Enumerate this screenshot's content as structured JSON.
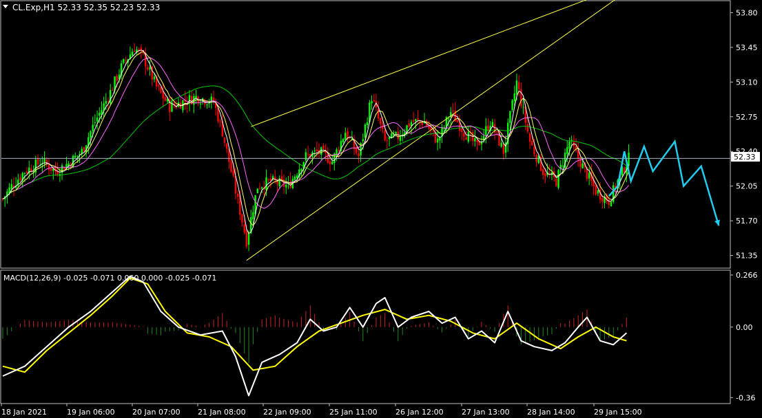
{
  "header": {
    "symbol_line": "CL.Exp,H1  52.33 52.35 52.23 52.33",
    "macd_line": "MACD(12,26,9) -0.025 -0.071 0.060 0.000 -0.025 -0.071"
  },
  "colors": {
    "background": "#000000",
    "frame": "#c0c0c0",
    "bull_candle": "#00ff00",
    "bear_candle": "#ff0000",
    "ma_fast": "#ffffff",
    "ma_medium": "#ffff66",
    "ma_slow": "#ff66ff",
    "ma_long": "#00cc00",
    "trendline": "#ffff44",
    "projection": "#22ccee",
    "macd_line": "#ffffff",
    "signal_line": "#ffff00",
    "hist_positive": "#cc2222",
    "hist_negative": "#228822",
    "price_tag_bg": "#ffffff"
  },
  "chart_data": [
    {
      "type": "candlestick",
      "symbol": "CL.Exp",
      "timeframe": "H1",
      "last_price": "52.33",
      "y_ticks": [
        "53.80",
        "53.45",
        "53.10",
        "52.75",
        "52.40",
        "52.05",
        "51.70",
        "51.35"
      ],
      "ylim": [
        51.25,
        53.9
      ],
      "x_ticks": [
        "18 Jan 2021",
        "19 Jan 06:00",
        "20 Jan 07:00",
        "21 Jan 08:00",
        "22 Jan 09:00",
        "25 Jan 11:00",
        "26 Jan 12:00",
        "27 Jan 13:00",
        "28 Jan 14:00",
        "29 Jan 15:00"
      ],
      "close_path": [
        {
          "x": 0,
          "y": 51.92
        },
        {
          "x": 4,
          "y": 52.05
        },
        {
          "x": 10,
          "y": 52.2
        },
        {
          "x": 18,
          "y": 52.3
        },
        {
          "x": 24,
          "y": 52.2
        },
        {
          "x": 30,
          "y": 52.28
        },
        {
          "x": 36,
          "y": 52.4
        },
        {
          "x": 42,
          "y": 52.7
        },
        {
          "x": 48,
          "y": 52.95
        },
        {
          "x": 54,
          "y": 53.25
        },
        {
          "x": 60,
          "y": 53.45
        },
        {
          "x": 64,
          "y": 53.35
        },
        {
          "x": 70,
          "y": 53.05
        },
        {
          "x": 76,
          "y": 52.85
        },
        {
          "x": 82,
          "y": 52.9
        },
        {
          "x": 88,
          "y": 52.95
        },
        {
          "x": 96,
          "y": 52.9
        },
        {
          "x": 100,
          "y": 52.6
        },
        {
          "x": 104,
          "y": 52.2
        },
        {
          "x": 108,
          "y": 51.8
        },
        {
          "x": 111,
          "y": 51.5
        },
        {
          "x": 116,
          "y": 52.05
        },
        {
          "x": 122,
          "y": 52.1
        },
        {
          "x": 130,
          "y": 52.05
        },
        {
          "x": 138,
          "y": 52.35
        },
        {
          "x": 144,
          "y": 52.4
        },
        {
          "x": 150,
          "y": 52.3
        },
        {
          "x": 156,
          "y": 52.6
        },
        {
          "x": 162,
          "y": 52.35
        },
        {
          "x": 168,
          "y": 52.95
        },
        {
          "x": 174,
          "y": 52.5
        },
        {
          "x": 180,
          "y": 52.55
        },
        {
          "x": 186,
          "y": 52.7
        },
        {
          "x": 192,
          "y": 52.7
        },
        {
          "x": 198,
          "y": 52.5
        },
        {
          "x": 204,
          "y": 52.8
        },
        {
          "x": 210,
          "y": 52.6
        },
        {
          "x": 216,
          "y": 52.45
        },
        {
          "x": 222,
          "y": 52.7
        },
        {
          "x": 228,
          "y": 52.4
        },
        {
          "x": 234,
          "y": 53.1
        },
        {
          "x": 240,
          "y": 52.5
        },
        {
          "x": 246,
          "y": 52.2
        },
        {
          "x": 252,
          "y": 52.1
        },
        {
          "x": 258,
          "y": 52.5
        },
        {
          "x": 264,
          "y": 52.25
        },
        {
          "x": 270,
          "y": 52.0
        },
        {
          "x": 276,
          "y": 51.9
        },
        {
          "x": 280,
          "y": 52.1
        },
        {
          "x": 285,
          "y": 52.33
        }
      ],
      "series": [
        {
          "name": "",
          "values": []
        }
      ],
      "trendlines": [
        {
          "x": [
            113,
            280
          ],
          "y": [
            52.65,
            54.05
          ]
        },
        {
          "x": [
            111,
            280
          ],
          "y": [
            51.3,
            53.95
          ]
        }
      ],
      "projection": [
        {
          "x": 276,
          "y": 51.95
        },
        {
          "x": 280,
          "y": 52.05
        },
        {
          "x": 283,
          "y": 52.4
        },
        {
          "x": 286,
          "y": 52.1
        },
        {
          "x": 292,
          "y": 52.45
        },
        {
          "x": 296,
          "y": 52.2
        },
        {
          "x": 306,
          "y": 52.5
        },
        {
          "x": 310,
          "y": 52.05
        },
        {
          "x": 318,
          "y": 52.25
        },
        {
          "x": 326,
          "y": 51.65
        }
      ]
    },
    {
      "type": "macd",
      "title": "MACD(12,26,9)",
      "y_ticks": [
        "0.266",
        "0.00",
        "-0.36"
      ],
      "ylim": [
        -0.38,
        0.28
      ],
      "zero": 0.0,
      "macd_path": [
        {
          "x": 0,
          "y": -0.25
        },
        {
          "x": 10,
          "y": -0.2
        },
        {
          "x": 20,
          "y": -0.1
        },
        {
          "x": 30,
          "y": 0.0
        },
        {
          "x": 40,
          "y": 0.08
        },
        {
          "x": 50,
          "y": 0.18
        },
        {
          "x": 58,
          "y": 0.26
        },
        {
          "x": 64,
          "y": 0.23
        },
        {
          "x": 72,
          "y": 0.08
        },
        {
          "x": 80,
          "y": 0.0
        },
        {
          "x": 90,
          "y": -0.04
        },
        {
          "x": 100,
          "y": -0.02
        },
        {
          "x": 106,
          "y": -0.15
        },
        {
          "x": 112,
          "y": -0.35
        },
        {
          "x": 118,
          "y": -0.18
        },
        {
          "x": 126,
          "y": -0.14
        },
        {
          "x": 134,
          "y": -0.08
        },
        {
          "x": 140,
          "y": 0.04
        },
        {
          "x": 146,
          "y": -0.02
        },
        {
          "x": 152,
          "y": 0.0
        },
        {
          "x": 158,
          "y": 0.1
        },
        {
          "x": 164,
          "y": 0.0
        },
        {
          "x": 170,
          "y": 0.12
        },
        {
          "x": 174,
          "y": 0.15
        },
        {
          "x": 180,
          "y": 0.0
        },
        {
          "x": 186,
          "y": 0.05
        },
        {
          "x": 194,
          "y": 0.08
        },
        {
          "x": 200,
          "y": 0.02
        },
        {
          "x": 206,
          "y": 0.05
        },
        {
          "x": 212,
          "y": -0.06
        },
        {
          "x": 218,
          "y": -0.02
        },
        {
          "x": 224,
          "y": -0.08
        },
        {
          "x": 230,
          "y": 0.08
        },
        {
          "x": 236,
          "y": -0.07
        },
        {
          "x": 242,
          "y": -0.1
        },
        {
          "x": 250,
          "y": -0.12
        },
        {
          "x": 256,
          "y": -0.08
        },
        {
          "x": 262,
          "y": 0.0
        },
        {
          "x": 266,
          "y": 0.05
        },
        {
          "x": 272,
          "y": -0.07
        },
        {
          "x": 278,
          "y": -0.09
        },
        {
          "x": 284,
          "y": -0.03
        }
      ],
      "signal_path": [
        {
          "x": 0,
          "y": -0.2
        },
        {
          "x": 10,
          "y": -0.23
        },
        {
          "x": 20,
          "y": -0.12
        },
        {
          "x": 30,
          "y": -0.03
        },
        {
          "x": 40,
          "y": 0.06
        },
        {
          "x": 50,
          "y": 0.16
        },
        {
          "x": 58,
          "y": 0.25
        },
        {
          "x": 66,
          "y": 0.22
        },
        {
          "x": 74,
          "y": 0.08
        },
        {
          "x": 84,
          "y": -0.03
        },
        {
          "x": 94,
          "y": -0.05
        },
        {
          "x": 104,
          "y": -0.1
        },
        {
          "x": 114,
          "y": -0.22
        },
        {
          "x": 124,
          "y": -0.2
        },
        {
          "x": 134,
          "y": -0.1
        },
        {
          "x": 144,
          "y": -0.02
        },
        {
          "x": 154,
          "y": 0.02
        },
        {
          "x": 164,
          "y": 0.06
        },
        {
          "x": 174,
          "y": 0.09
        },
        {
          "x": 184,
          "y": 0.04
        },
        {
          "x": 194,
          "y": 0.06
        },
        {
          "x": 204,
          "y": 0.03
        },
        {
          "x": 214,
          "y": -0.03
        },
        {
          "x": 224,
          "y": -0.06
        },
        {
          "x": 234,
          "y": 0.02
        },
        {
          "x": 244,
          "y": -0.06
        },
        {
          "x": 254,
          "y": -0.11
        },
        {
          "x": 262,
          "y": -0.05
        },
        {
          "x": 270,
          "y": 0.0
        },
        {
          "x": 278,
          "y": -0.05
        },
        {
          "x": 284,
          "y": -0.07
        }
      ]
    }
  ]
}
